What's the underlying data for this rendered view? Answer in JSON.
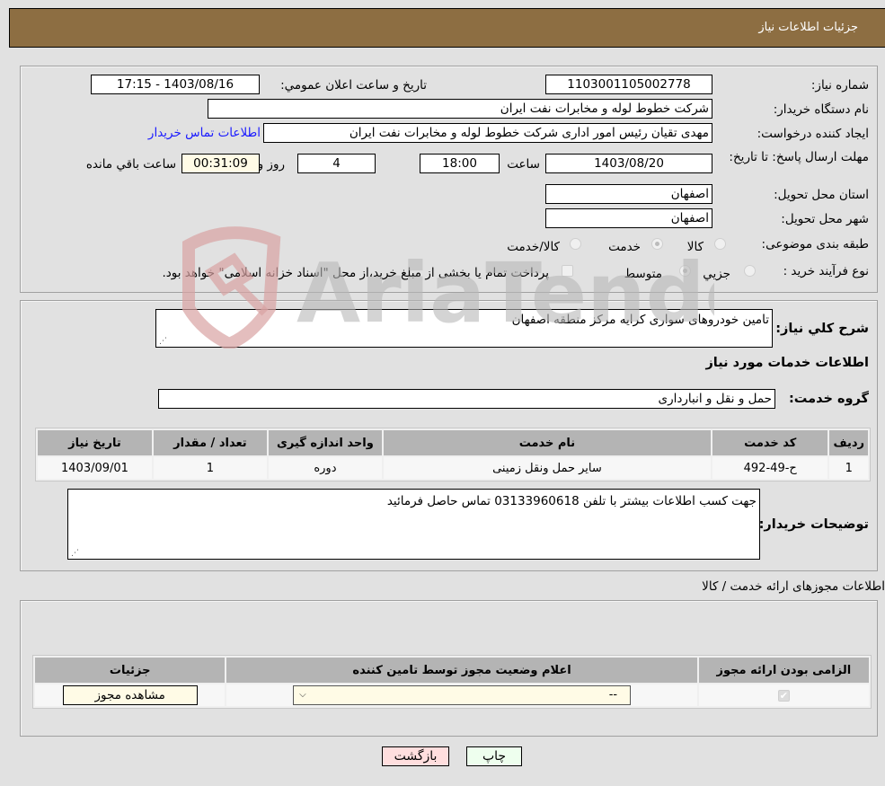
{
  "header": {
    "title": "جزئیات اطلاعات نیاز"
  },
  "details": {
    "need_number_label": "شماره نیاز:",
    "need_number": "1103001105002778",
    "announce_label": "تاریخ و ساعت اعلان عمومي:",
    "announce_value": "1403/08/16 - 17:15",
    "buyer_org_label": "نام دستگاه خریدار:",
    "buyer_org": "شرکت خطوط لوله و مخابرات نفت ایران",
    "creator_label": "ایجاد کننده درخواست:",
    "creator": "مهدی  تقیان رئیس امور اداری  شرکت خطوط لوله و مخابرات نفت ایران",
    "buyer_contact_link": "اطلاعات تماس خریدار",
    "deadline_label": "مهلت ارسال پاسخ: تا تاریخ:",
    "deadline_date": "1403/08/20",
    "time_label": "ساعت",
    "deadline_time": "18:00",
    "days_value": "4",
    "days_label": "روز و",
    "remaining_time": "00:31:09",
    "remaining_label": "ساعت باقي مانده",
    "province_label": "استان محل تحویل:",
    "province": "اصفهان",
    "city_label": "شهر محل تحویل:",
    "city": "اصفهان",
    "category_label": "طبقه بندی موضوعی:",
    "category_options": [
      {
        "label": "کالا",
        "selected": false
      },
      {
        "label": "خدمت",
        "selected": true
      },
      {
        "label": "کالا/خدمت",
        "selected": false
      }
    ],
    "process_label": "نوع فرآیند خرید :",
    "process_options": [
      {
        "label": "جزيي",
        "selected": false
      },
      {
        "label": "متوسط",
        "selected": true
      }
    ],
    "treasury_checkbox_label": "پرداخت تمام یا بخشی از مبلغ خرید،از محل \"اسناد خزانه اسلامی\" خواهد بود.",
    "treasury_checked": false
  },
  "need": {
    "summary_label": "شرح کلي نیاز:",
    "summary": "تامین خودروهای سواری کرایه مرکز منطقه اصفهان",
    "services_heading": "اطلاعات خدمات مورد نیاز",
    "service_group_label": "گروه خدمت:",
    "service_group": "حمل و نقل و انبارداری",
    "table": {
      "headers": [
        "ردیف",
        "کد خدمت",
        "نام خدمت",
        "واحد اندازه گیری",
        "تعداد / مقدار",
        "تاریخ نیاز"
      ],
      "rows": [
        [
          "1",
          "ح-49-492",
          "سایر حمل ونقل زمینی",
          "دوره",
          "1",
          "1403/09/01"
        ]
      ]
    },
    "buyer_notes_label": "توضیحات خریدار:",
    "buyer_notes": "جهت کسب اطلاعات بیشتر با تلفن 03133960618 تماس حاصل فرمائید"
  },
  "permits": {
    "title": "اطلاعات مجوزهای ارائه خدمت / کالا",
    "headers": [
      "الزامی بودن ارائه مجوز",
      "اعلام وضعیت مجوز توسط تامین کننده",
      "جزئیات"
    ],
    "row": {
      "required_checked": true,
      "status_value": "--",
      "view_button": "مشاهده مجوز"
    }
  },
  "buttons": {
    "print": "چاپ",
    "back": "بازگشت"
  },
  "watermark": {
    "text": "AriaTender.neT"
  }
}
